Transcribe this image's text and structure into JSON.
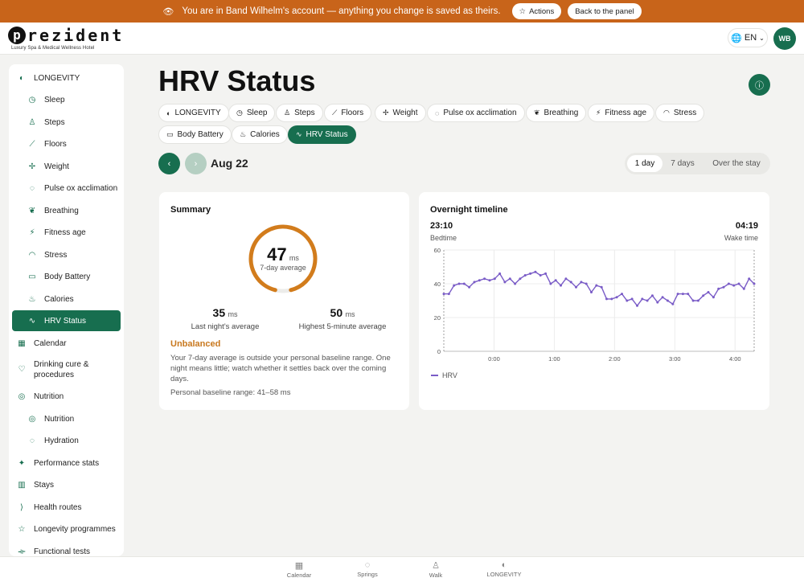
{
  "banner": {
    "message": "You are in Band Wilhelm's account — anything you change is saved as theirs.",
    "actions_label": "Actions",
    "back_label": "Back to the panel"
  },
  "header": {
    "brand": "rezident",
    "brand_initial": "p",
    "tagline": "Luxury Spa & Medical Wellness Hotel",
    "lang": "EN",
    "avatar_initials": "WB"
  },
  "sidebar": {
    "items": [
      {
        "label": "LONGEVITY",
        "icon": "longevity-icon"
      },
      {
        "label": "Sleep",
        "icon": "clock-icon"
      },
      {
        "label": "Steps",
        "icon": "walk-icon"
      },
      {
        "label": "Floors",
        "icon": "stairs-icon"
      },
      {
        "label": "Weight",
        "icon": "weight-icon"
      },
      {
        "label": "Pulse ox acclimation",
        "icon": "drop-icon"
      },
      {
        "label": "Breathing",
        "icon": "lungs-icon"
      },
      {
        "label": "Fitness age",
        "icon": "run-icon"
      },
      {
        "label": "Stress",
        "icon": "gauge-icon"
      },
      {
        "label": "Body Battery",
        "icon": "battery-icon"
      },
      {
        "label": "Calories",
        "icon": "flame-icon"
      },
      {
        "label": "HRV Status",
        "icon": "pulse-icon"
      },
      {
        "label": "Calendar",
        "icon": "calendar-icon"
      },
      {
        "label": "Drinking cure & procedures",
        "icon": "heart-icon"
      },
      {
        "label": "Nutrition",
        "icon": "target-icon"
      },
      {
        "label": "Nutrition",
        "icon": "target-icon"
      },
      {
        "label": "Hydration",
        "icon": "drop-icon"
      },
      {
        "label": "Performance stats",
        "icon": "sparkle-icon"
      },
      {
        "label": "Stays",
        "icon": "building-icon"
      },
      {
        "label": "Health routes",
        "icon": "route-icon"
      },
      {
        "label": "Longevity programmes",
        "icon": "star-icon"
      },
      {
        "label": "Functional tests",
        "icon": "dumbbell-icon"
      }
    ]
  },
  "main": {
    "title": "HRV Status",
    "chips": [
      {
        "label": "LONGEVITY",
        "icon": "longevity-icon"
      },
      {
        "label": "Sleep",
        "icon": "clock-icon"
      },
      {
        "label": "Steps",
        "icon": "walk-icon"
      },
      {
        "label": "Floors",
        "icon": "stairs-icon"
      },
      {
        "label": "Weight",
        "icon": "weight-icon"
      },
      {
        "label": "Pulse ox acclimation",
        "icon": "drop-icon"
      },
      {
        "label": "Breathing",
        "icon": "lungs-icon"
      },
      {
        "label": "Fitness age",
        "icon": "run-icon"
      },
      {
        "label": "Stress",
        "icon": "gauge-icon"
      },
      {
        "label": "Body Battery",
        "icon": "battery-icon"
      },
      {
        "label": "Calories",
        "icon": "flame-icon"
      },
      {
        "label": "HRV Status",
        "icon": "pulse-icon"
      }
    ],
    "date": "Aug 22",
    "periods": [
      "1 day",
      "7 days",
      "Over the stay"
    ]
  },
  "summary": {
    "title": "Summary",
    "avg_value": "47",
    "avg_unit": "ms",
    "avg_label": "7-day average",
    "gauge_fraction": 0.92,
    "last_night_value": "35",
    "last_night_unit": "ms",
    "last_night_label": "Last night's average",
    "highest_value": "50",
    "highest_unit": "ms",
    "highest_label": "Highest 5-minute average",
    "status": "Unbalanced",
    "description": "Your 7-day average is outside your personal baseline range. One night means little; watch whether it settles back over the coming days.",
    "baseline": "Personal baseline range: 41–58 ms"
  },
  "timeline": {
    "title": "Overnight timeline",
    "bedtime": "23:10",
    "bedtime_label": "Bedtime",
    "waketime": "04:19",
    "waketime_label": "Wake time"
  },
  "chart_data": {
    "type": "line",
    "title": "",
    "xlabel": "",
    "ylabel": "",
    "ylim": [
      0,
      60
    ],
    "yticks": [
      0,
      20,
      40,
      60
    ],
    "xticks": [
      "0:00",
      "1:00",
      "2:00",
      "3:00",
      "4:00"
    ],
    "x_start_min": -50,
    "x_end_min": 259,
    "series": [
      {
        "name": "HRV",
        "color": "#7a5cc7",
        "values": [
          34,
          34,
          39,
          40,
          40,
          38,
          41,
          42,
          43,
          42,
          43,
          46,
          41,
          43,
          40,
          43,
          45,
          46,
          47,
          45,
          46,
          40,
          42,
          39,
          43,
          41,
          38,
          41,
          40,
          35,
          39,
          38,
          31,
          31,
          32,
          34,
          30,
          31,
          27,
          31,
          30,
          33,
          29,
          32,
          30,
          28,
          34,
          34,
          34,
          30,
          30,
          33,
          35,
          32,
          37,
          38,
          40,
          39,
          40,
          37,
          43,
          40
        ]
      }
    ]
  },
  "bottom_nav": [
    {
      "label": "Calendar",
      "icon": "calendar-icon"
    },
    {
      "label": "Springs",
      "icon": "drop-icon"
    },
    {
      "label": "Walk",
      "icon": "walk-icon"
    },
    {
      "label": "LONGEVITY",
      "icon": "longevity-icon"
    }
  ]
}
